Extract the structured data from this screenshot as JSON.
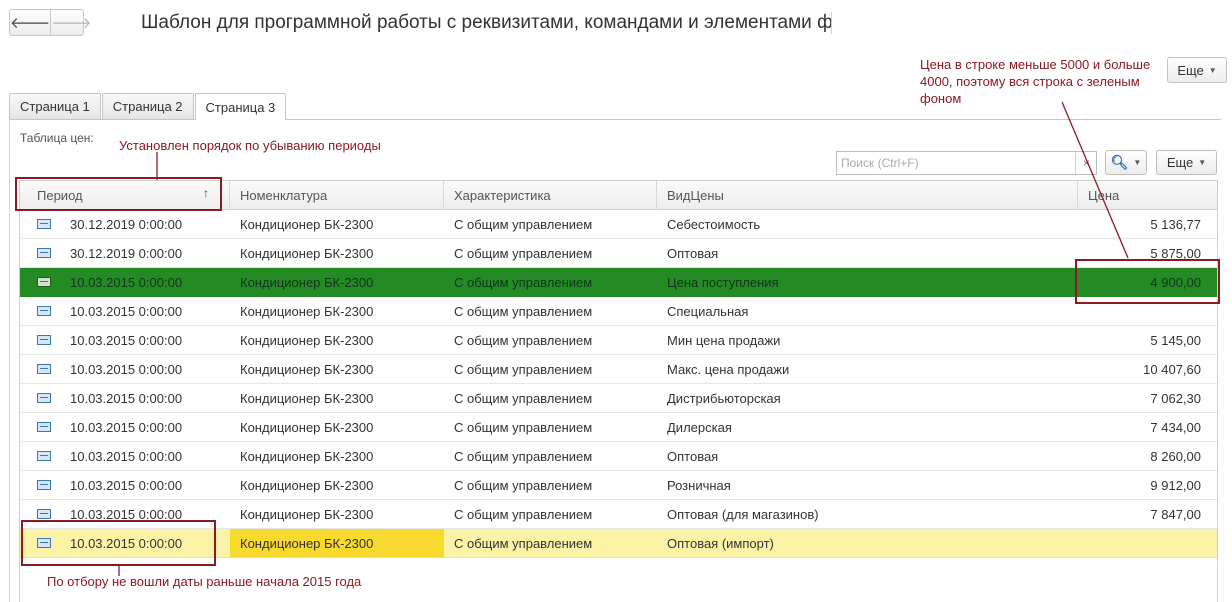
{
  "window": {
    "title": "Шаблон для программной работы с реквизитами, командами и элементами фо",
    "back_icon": "arrow-left-icon",
    "forward_icon": "arrow-right-icon",
    "more_label": "Еще"
  },
  "tabs": [
    {
      "label": "Страница 1",
      "active": false
    },
    {
      "label": "Страница 2",
      "active": false
    },
    {
      "label": "Страница 3",
      "active": true
    }
  ],
  "table": {
    "label": "Таблица цен:",
    "search_placeholder": "Поиск (Ctrl+F)",
    "clear_glyph": "×",
    "more_label": "Еще",
    "columns": [
      "Период",
      "Номенклатура",
      "Характеристика",
      "ВидЦены",
      "Цена"
    ],
    "sort_glyph": "↑",
    "rows": [
      {
        "period": "30.12.2019 0:00:00",
        "item": "Кондиционер БК-2300",
        "characteristic": "С общим управлением",
        "price_type": "Себестоимость",
        "price": "5 136,77",
        "style": ""
      },
      {
        "period": "30.12.2019 0:00:00",
        "item": "Кондиционер БК-2300",
        "characteristic": "С общим управлением",
        "price_type": "Оптовая",
        "price": "5 875,00",
        "style": ""
      },
      {
        "period": "10.03.2015 0:00:00",
        "item": "Кондиционер БК-2300",
        "characteristic": "С общим управлением",
        "price_type": "Цена поступления",
        "price": "4 900,00",
        "style": "green"
      },
      {
        "period": "10.03.2015 0:00:00",
        "item": "Кондиционер БК-2300",
        "characteristic": "С общим управлением",
        "price_type": "Специальная",
        "price": "",
        "style": ""
      },
      {
        "period": "10.03.2015 0:00:00",
        "item": "Кондиционер БК-2300",
        "characteristic": "С общим управлением",
        "price_type": "Мин цена продажи",
        "price": "5 145,00",
        "style": ""
      },
      {
        "period": "10.03.2015 0:00:00",
        "item": "Кондиционер БК-2300",
        "characteristic": "С общим управлением",
        "price_type": "Макс. цена продажи",
        "price": "10 407,60",
        "style": ""
      },
      {
        "period": "10.03.2015 0:00:00",
        "item": "Кондиционер БК-2300",
        "characteristic": "С общим управлением",
        "price_type": "Дистрибьюторская",
        "price": "7 062,30",
        "style": ""
      },
      {
        "period": "10.03.2015 0:00:00",
        "item": "Кондиционер БК-2300",
        "characteristic": "С общим управлением",
        "price_type": "Дилерская",
        "price": "7 434,00",
        "style": ""
      },
      {
        "period": "10.03.2015 0:00:00",
        "item": "Кондиционер БК-2300",
        "characteristic": "С общим управлением",
        "price_type": "Оптовая",
        "price": "8 260,00",
        "style": ""
      },
      {
        "period": "10.03.2015 0:00:00",
        "item": "Кондиционер БК-2300",
        "characteristic": "С общим управлением",
        "price_type": "Розничная",
        "price": "9 912,00",
        "style": ""
      },
      {
        "period": "10.03.2015 0:00:00",
        "item": "Кондиционер БК-2300",
        "characteristic": "С общим управлением",
        "price_type": "Оптовая (для магазинов)",
        "price": "7 847,00",
        "style": ""
      },
      {
        "period": "10.03.2015 0:00:00",
        "item": "Кондиционер БК-2300",
        "characteristic": "С общим управлением",
        "price_type": "Оптовая (импорт)",
        "price": "",
        "style": "yellow"
      }
    ]
  },
  "annotations": {
    "sort_note": "Установлен порядок по убыванию периоды",
    "price_note": "Цена в строке меньше 5000 и больше 4000, поэтому вся строка с зеленым фоном",
    "filter_note": "По отбору не вошли даты раньше начала 2015 года",
    "color": "#8b1a22"
  },
  "colors": {
    "green_row": "#248a24",
    "yellow_row": "#fdf3a6",
    "yellow_cell": "#f8d92d"
  }
}
